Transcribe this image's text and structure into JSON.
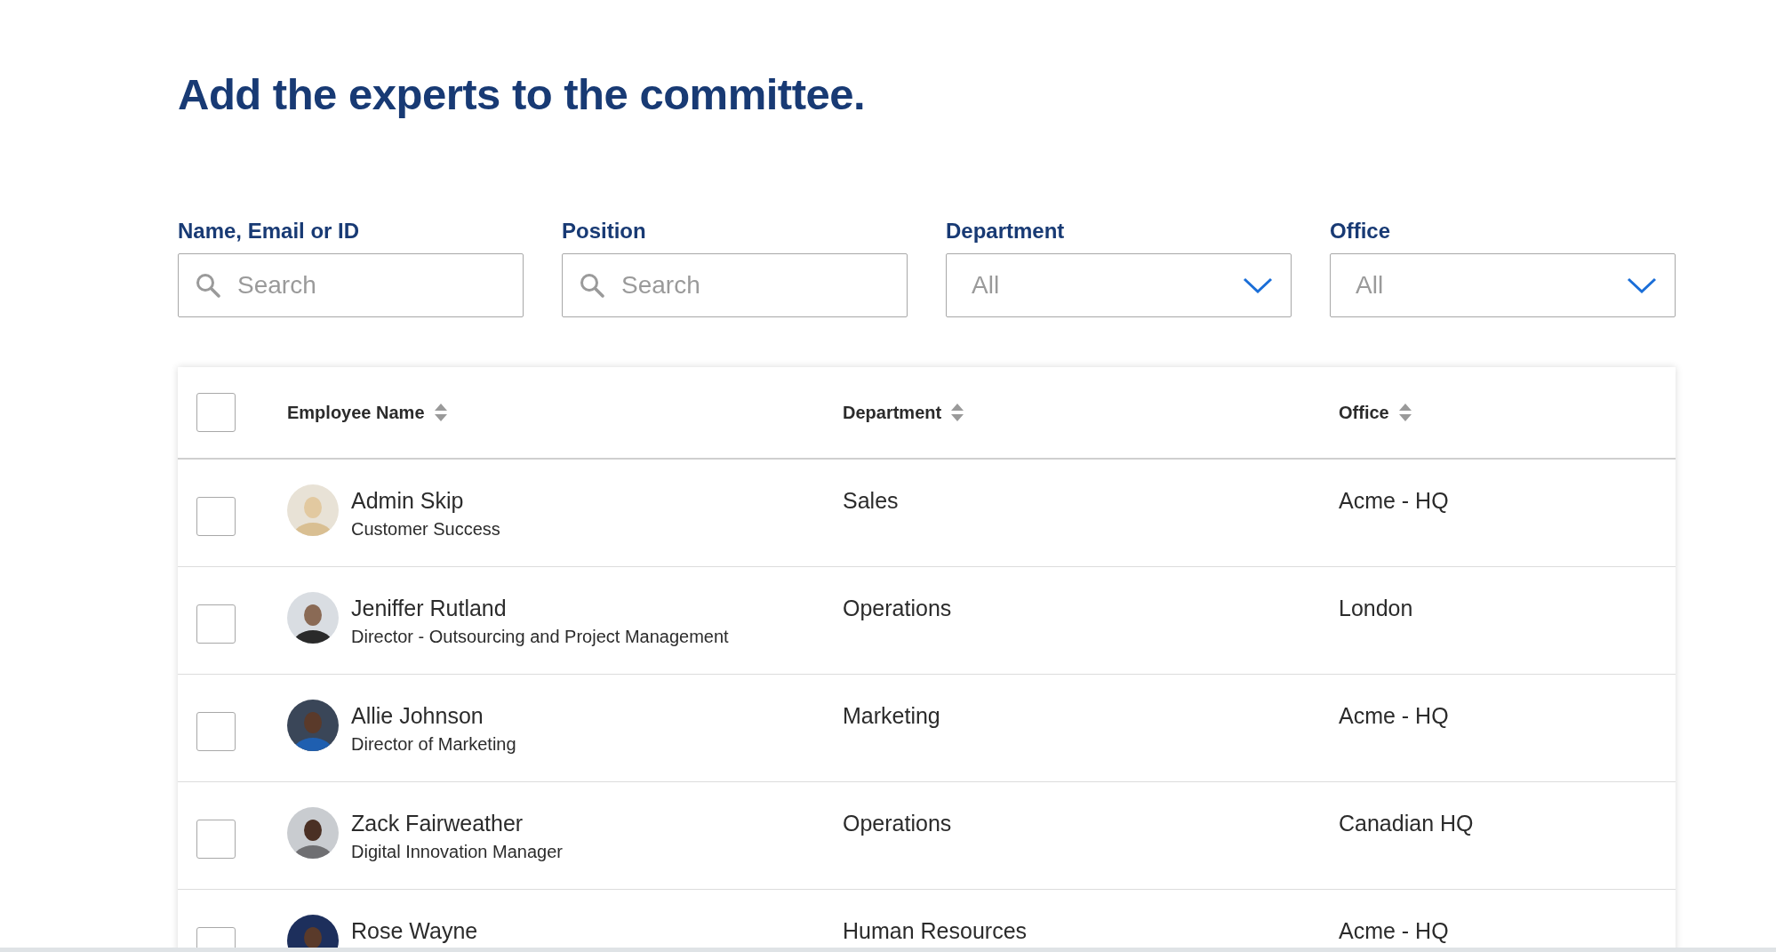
{
  "title": "Add the experts to the committee.",
  "filters": [
    {
      "kind": "search",
      "label": "Name, Email or ID",
      "placeholder": "Search"
    },
    {
      "kind": "search",
      "label": "Position",
      "placeholder": "Search"
    },
    {
      "kind": "select",
      "label": "Department",
      "value": "All"
    },
    {
      "kind": "select",
      "label": "Office",
      "value": "All"
    }
  ],
  "table": {
    "select_all": {
      "checked": false
    },
    "columns": [
      {
        "label": "Employee Name"
      },
      {
        "label": "Department"
      },
      {
        "label": "Office"
      }
    ],
    "rows": [
      {
        "selected": false,
        "name": "Admin Skip",
        "position": "Customer Success",
        "department": "Sales",
        "office": "Acme - HQ"
      },
      {
        "selected": false,
        "name": "Jeniffer Rutland",
        "position": "Director - Outsourcing and Project Management",
        "department": "Operations",
        "office": "London"
      },
      {
        "selected": false,
        "name": "Allie Johnson",
        "position": "Director of Marketing",
        "department": "Marketing",
        "office": "Acme - HQ"
      },
      {
        "selected": false,
        "name": "Zack Fairweather",
        "position": "Digital Innovation Manager",
        "department": "Operations",
        "office": "Canadian HQ"
      },
      {
        "selected": false,
        "name": "Rose Wayne",
        "department": "Human Resources",
        "office": "Acme - HQ"
      }
    ]
  }
}
